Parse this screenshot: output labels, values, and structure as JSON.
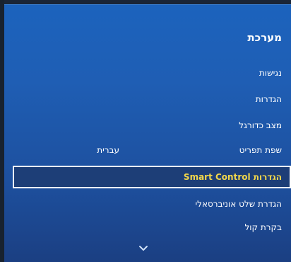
{
  "menu": {
    "title": "מערכת",
    "items": [
      {
        "label": "נגישות"
      },
      {
        "label": "הגדרות"
      },
      {
        "label": "מצב כדורגל"
      },
      {
        "label": "שפת תפריט",
        "value": "עברית"
      },
      {
        "label": "הגדרות Smart Control",
        "selected": true
      },
      {
        "label": "הגדרת שלט אוניברסאלי"
      },
      {
        "label": "בקרת קול"
      }
    ],
    "more_icon": "chevron-down-icon",
    "highlight_color": "#f2d74a"
  }
}
